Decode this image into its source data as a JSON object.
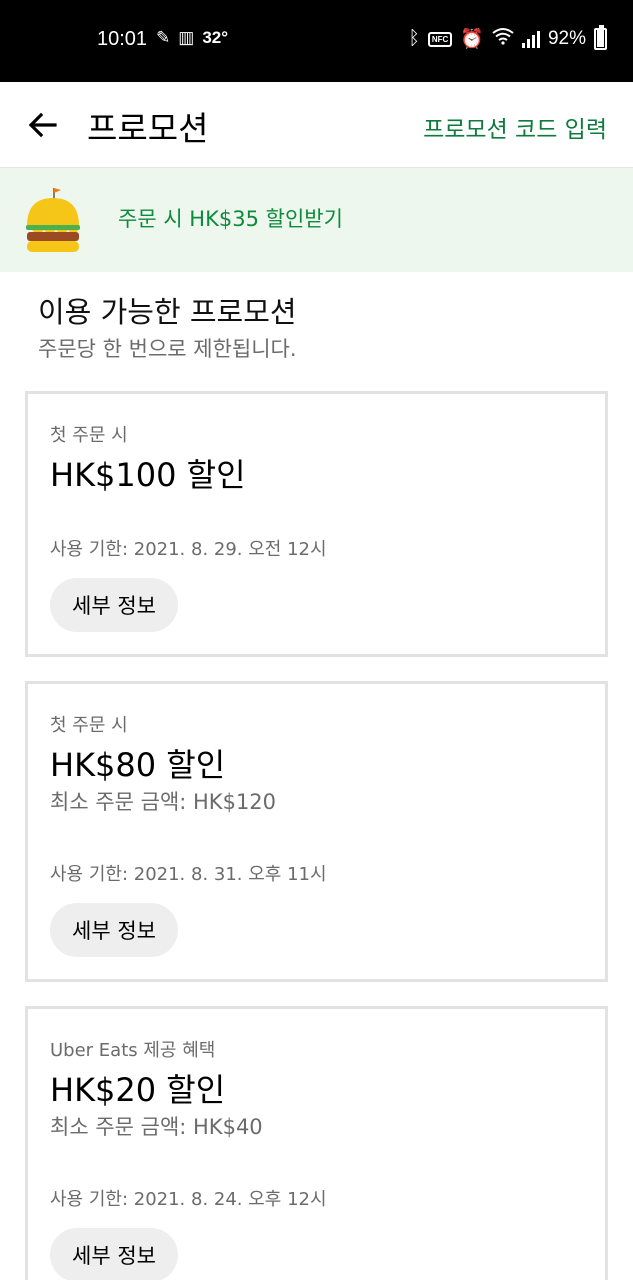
{
  "status_bar": {
    "time": "10:01",
    "temperature": "32°",
    "battery_percent": "92%",
    "battery_level": 0.92
  },
  "header": {
    "title": "프로모션",
    "promo_code_link": "프로모션 코드 입력"
  },
  "banner": {
    "text": "주문 시 HK$35 할인받기"
  },
  "section": {
    "title": "이용 가능한 프로모션",
    "subtitle": "주문당 한 번으로 제한됩니다."
  },
  "promotions": [
    {
      "eyebrow": "첫 주문 시",
      "amount": "HK$100 할인",
      "min_order": "",
      "expiry": "사용 기한: 2021. 8. 29. 오전 12시",
      "details_label": "세부 정보"
    },
    {
      "eyebrow": "첫 주문 시",
      "amount": "HK$80 할인",
      "min_order": "최소 주문 금액: HK$120",
      "expiry": "사용 기한: 2021. 8. 31. 오후 11시",
      "details_label": "세부 정보"
    },
    {
      "eyebrow": "Uber Eats 제공 혜택",
      "amount": "HK$20 할인",
      "min_order": "최소 주문 금액: HK$40",
      "expiry": "사용 기한: 2021. 8. 24. 오후 12시",
      "details_label": "세부 정보"
    }
  ],
  "colors": {
    "accent_green": "#0e8a3c",
    "banner_bg": "#eef7ee",
    "card_border": "#e2e2e2",
    "button_bg": "#eeeeee"
  }
}
